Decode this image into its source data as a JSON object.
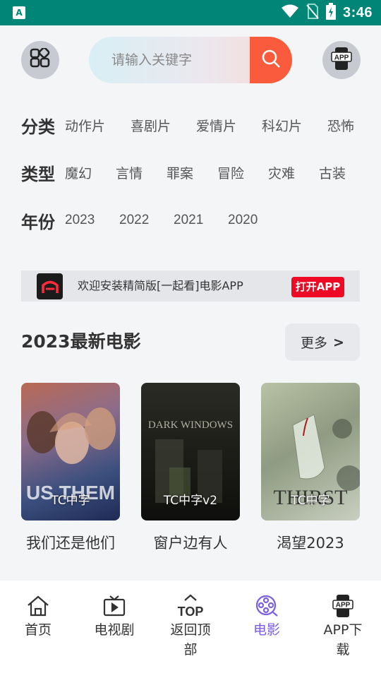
{
  "status_bar": {
    "time": "3:46",
    "app_letter": "A"
  },
  "search": {
    "placeholder": "请输入关键字"
  },
  "header": {
    "app_icon_label": "APP"
  },
  "filters": {
    "category": {
      "title": "分类",
      "items": [
        "动作片",
        "喜剧片",
        "爱情片",
        "科幻片",
        "恐怖"
      ]
    },
    "type": {
      "title": "类型",
      "items": [
        "魔幻",
        "言情",
        "罪案",
        "冒险",
        "灾难",
        "古装"
      ]
    },
    "year": {
      "title": "年份",
      "items": [
        "2023",
        "2022",
        "2021",
        "2020"
      ]
    }
  },
  "banner": {
    "text": "欢迎安装精简版[一起看]电影APP",
    "button": "打开APP"
  },
  "section": {
    "title": "2023最新电影",
    "more_label": "更多",
    "more_arrow": ">"
  },
  "movies": [
    {
      "title": "我们还是他们",
      "tag": "TC中字",
      "poster_text": "US THEM"
    },
    {
      "title": "窗户边有人",
      "tag": "TC中字v2",
      "poster_text": "DARK WINDOWS"
    },
    {
      "title": "渴望2023",
      "tag": "TC中字",
      "poster_text": "THIRST"
    }
  ],
  "nav": [
    {
      "label": "首页",
      "icon": "home-icon"
    },
    {
      "label": "电视剧",
      "icon": "tv-icon"
    },
    {
      "label": "返回顶部",
      "icon": "top-icon",
      "icon_text": "TOP"
    },
    {
      "label": "电影",
      "icon": "film-reel-icon",
      "active": true
    },
    {
      "label": "APP下载",
      "icon": "app-download-icon",
      "icon_text": "APP"
    }
  ],
  "colors": {
    "status_bar": "#008577",
    "search_button": "#fa5b3c",
    "active_nav": "#7b5ee3",
    "open_app": "#ee0a24"
  }
}
